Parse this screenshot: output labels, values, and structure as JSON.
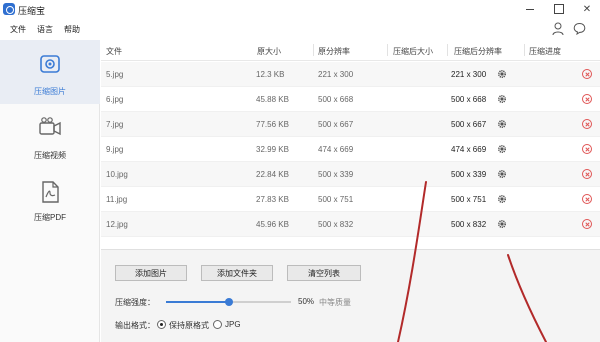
{
  "app": {
    "title": "压缩宝"
  },
  "menu": [
    "文件",
    "语言",
    "帮助"
  ],
  "sidebar": {
    "items": [
      {
        "label": "压缩图片",
        "icon": "image-compress-icon",
        "active": true
      },
      {
        "label": "压缩视频",
        "icon": "video-compress-icon",
        "active": false
      },
      {
        "label": "压缩PDF",
        "icon": "pdf-compress-icon",
        "active": false
      }
    ]
  },
  "table": {
    "headers": [
      "文件",
      "原大小",
      "原分辨率",
      "压缩后大小",
      "压缩后分辨率",
      "压缩进度"
    ],
    "rows": [
      {
        "file": "5.jpg",
        "size": "12.3 KB",
        "res": "221 x 300",
        "new_res": "221 x 300"
      },
      {
        "file": "6.jpg",
        "size": "45.88 KB",
        "res": "500 x 668",
        "new_res": "500 x 668"
      },
      {
        "file": "7.jpg",
        "size": "77.56 KB",
        "res": "500 x 667",
        "new_res": "500 x 667"
      },
      {
        "file": "9.jpg",
        "size": "32.99 KB",
        "res": "474 x 669",
        "new_res": "474 x 669"
      },
      {
        "file": "10.jpg",
        "size": "22.84 KB",
        "res": "500 x 339",
        "new_res": "500 x 339"
      },
      {
        "file": "11.jpg",
        "size": "27.83 KB",
        "res": "500 x 751",
        "new_res": "500 x 751"
      },
      {
        "file": "12.jpg",
        "size": "45.96 KB",
        "res": "500 x 832",
        "new_res": "500 x 832"
      }
    ]
  },
  "actions": {
    "add_image": "添加图片",
    "add_folder": "添加文件夹",
    "clear_list": "清空列表"
  },
  "strength": {
    "label": "压缩强度：",
    "value_text": "50%",
    "level_text": "中等质量",
    "value": 0.5
  },
  "format": {
    "label": "输出格式：",
    "keep": "保持原格式",
    "jpg": "JPG"
  },
  "colors": {
    "accent": "#3a7bd5",
    "delete": "#e05555",
    "annotation": "#b22a2a"
  }
}
